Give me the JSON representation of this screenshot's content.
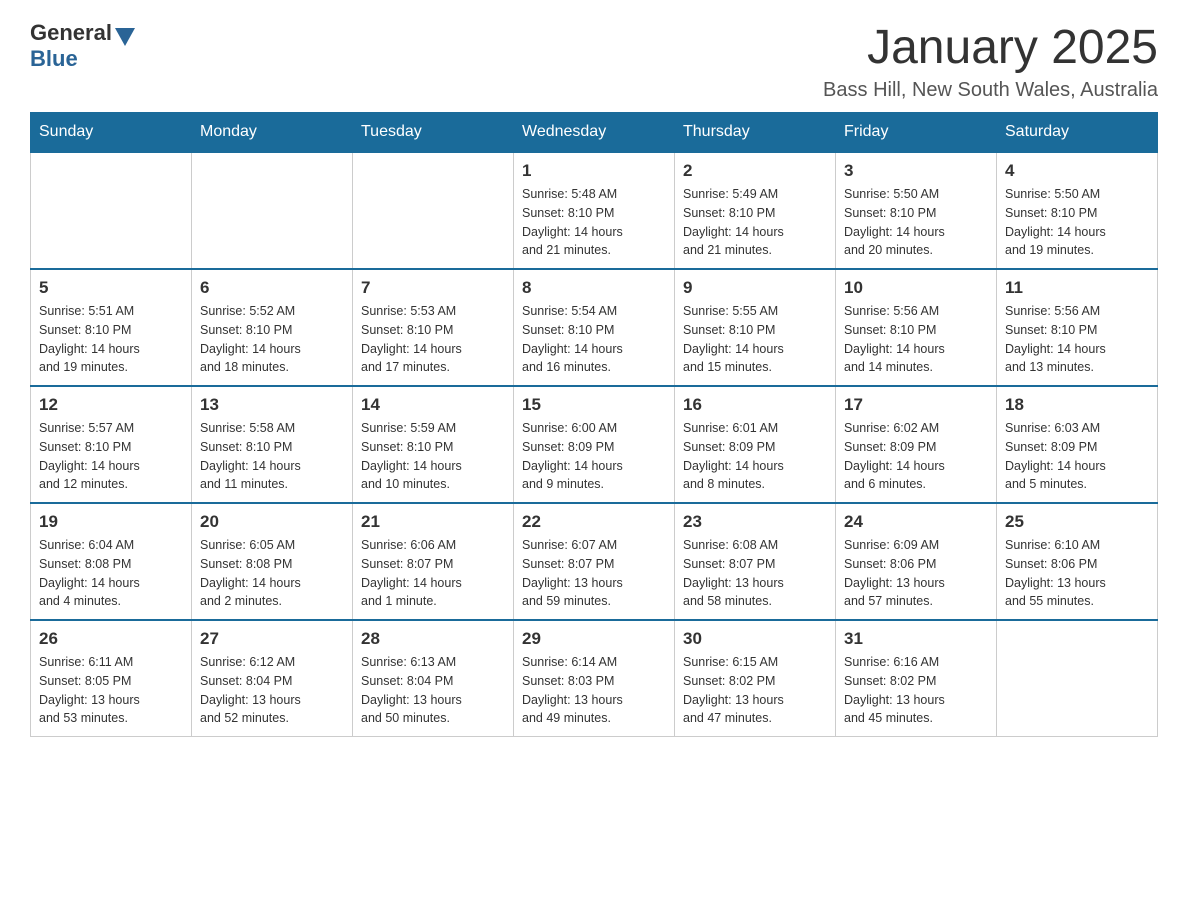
{
  "header": {
    "logo_general": "General",
    "logo_blue": "Blue",
    "month_title": "January 2025",
    "location": "Bass Hill, New South Wales, Australia"
  },
  "days_of_week": [
    "Sunday",
    "Monday",
    "Tuesday",
    "Wednesday",
    "Thursday",
    "Friday",
    "Saturday"
  ],
  "weeks": [
    {
      "days": [
        {
          "number": "",
          "info": ""
        },
        {
          "number": "",
          "info": ""
        },
        {
          "number": "",
          "info": ""
        },
        {
          "number": "1",
          "info": "Sunrise: 5:48 AM\nSunset: 8:10 PM\nDaylight: 14 hours\nand 21 minutes."
        },
        {
          "number": "2",
          "info": "Sunrise: 5:49 AM\nSunset: 8:10 PM\nDaylight: 14 hours\nand 21 minutes."
        },
        {
          "number": "3",
          "info": "Sunrise: 5:50 AM\nSunset: 8:10 PM\nDaylight: 14 hours\nand 20 minutes."
        },
        {
          "number": "4",
          "info": "Sunrise: 5:50 AM\nSunset: 8:10 PM\nDaylight: 14 hours\nand 19 minutes."
        }
      ]
    },
    {
      "days": [
        {
          "number": "5",
          "info": "Sunrise: 5:51 AM\nSunset: 8:10 PM\nDaylight: 14 hours\nand 19 minutes."
        },
        {
          "number": "6",
          "info": "Sunrise: 5:52 AM\nSunset: 8:10 PM\nDaylight: 14 hours\nand 18 minutes."
        },
        {
          "number": "7",
          "info": "Sunrise: 5:53 AM\nSunset: 8:10 PM\nDaylight: 14 hours\nand 17 minutes."
        },
        {
          "number": "8",
          "info": "Sunrise: 5:54 AM\nSunset: 8:10 PM\nDaylight: 14 hours\nand 16 minutes."
        },
        {
          "number": "9",
          "info": "Sunrise: 5:55 AM\nSunset: 8:10 PM\nDaylight: 14 hours\nand 15 minutes."
        },
        {
          "number": "10",
          "info": "Sunrise: 5:56 AM\nSunset: 8:10 PM\nDaylight: 14 hours\nand 14 minutes."
        },
        {
          "number": "11",
          "info": "Sunrise: 5:56 AM\nSunset: 8:10 PM\nDaylight: 14 hours\nand 13 minutes."
        }
      ]
    },
    {
      "days": [
        {
          "number": "12",
          "info": "Sunrise: 5:57 AM\nSunset: 8:10 PM\nDaylight: 14 hours\nand 12 minutes."
        },
        {
          "number": "13",
          "info": "Sunrise: 5:58 AM\nSunset: 8:10 PM\nDaylight: 14 hours\nand 11 minutes."
        },
        {
          "number": "14",
          "info": "Sunrise: 5:59 AM\nSunset: 8:10 PM\nDaylight: 14 hours\nand 10 minutes."
        },
        {
          "number": "15",
          "info": "Sunrise: 6:00 AM\nSunset: 8:09 PM\nDaylight: 14 hours\nand 9 minutes."
        },
        {
          "number": "16",
          "info": "Sunrise: 6:01 AM\nSunset: 8:09 PM\nDaylight: 14 hours\nand 8 minutes."
        },
        {
          "number": "17",
          "info": "Sunrise: 6:02 AM\nSunset: 8:09 PM\nDaylight: 14 hours\nand 6 minutes."
        },
        {
          "number": "18",
          "info": "Sunrise: 6:03 AM\nSunset: 8:09 PM\nDaylight: 14 hours\nand 5 minutes."
        }
      ]
    },
    {
      "days": [
        {
          "number": "19",
          "info": "Sunrise: 6:04 AM\nSunset: 8:08 PM\nDaylight: 14 hours\nand 4 minutes."
        },
        {
          "number": "20",
          "info": "Sunrise: 6:05 AM\nSunset: 8:08 PM\nDaylight: 14 hours\nand 2 minutes."
        },
        {
          "number": "21",
          "info": "Sunrise: 6:06 AM\nSunset: 8:07 PM\nDaylight: 14 hours\nand 1 minute."
        },
        {
          "number": "22",
          "info": "Sunrise: 6:07 AM\nSunset: 8:07 PM\nDaylight: 13 hours\nand 59 minutes."
        },
        {
          "number": "23",
          "info": "Sunrise: 6:08 AM\nSunset: 8:07 PM\nDaylight: 13 hours\nand 58 minutes."
        },
        {
          "number": "24",
          "info": "Sunrise: 6:09 AM\nSunset: 8:06 PM\nDaylight: 13 hours\nand 57 minutes."
        },
        {
          "number": "25",
          "info": "Sunrise: 6:10 AM\nSunset: 8:06 PM\nDaylight: 13 hours\nand 55 minutes."
        }
      ]
    },
    {
      "days": [
        {
          "number": "26",
          "info": "Sunrise: 6:11 AM\nSunset: 8:05 PM\nDaylight: 13 hours\nand 53 minutes."
        },
        {
          "number": "27",
          "info": "Sunrise: 6:12 AM\nSunset: 8:04 PM\nDaylight: 13 hours\nand 52 minutes."
        },
        {
          "number": "28",
          "info": "Sunrise: 6:13 AM\nSunset: 8:04 PM\nDaylight: 13 hours\nand 50 minutes."
        },
        {
          "number": "29",
          "info": "Sunrise: 6:14 AM\nSunset: 8:03 PM\nDaylight: 13 hours\nand 49 minutes."
        },
        {
          "number": "30",
          "info": "Sunrise: 6:15 AM\nSunset: 8:02 PM\nDaylight: 13 hours\nand 47 minutes."
        },
        {
          "number": "31",
          "info": "Sunrise: 6:16 AM\nSunset: 8:02 PM\nDaylight: 13 hours\nand 45 minutes."
        },
        {
          "number": "",
          "info": ""
        }
      ]
    }
  ]
}
